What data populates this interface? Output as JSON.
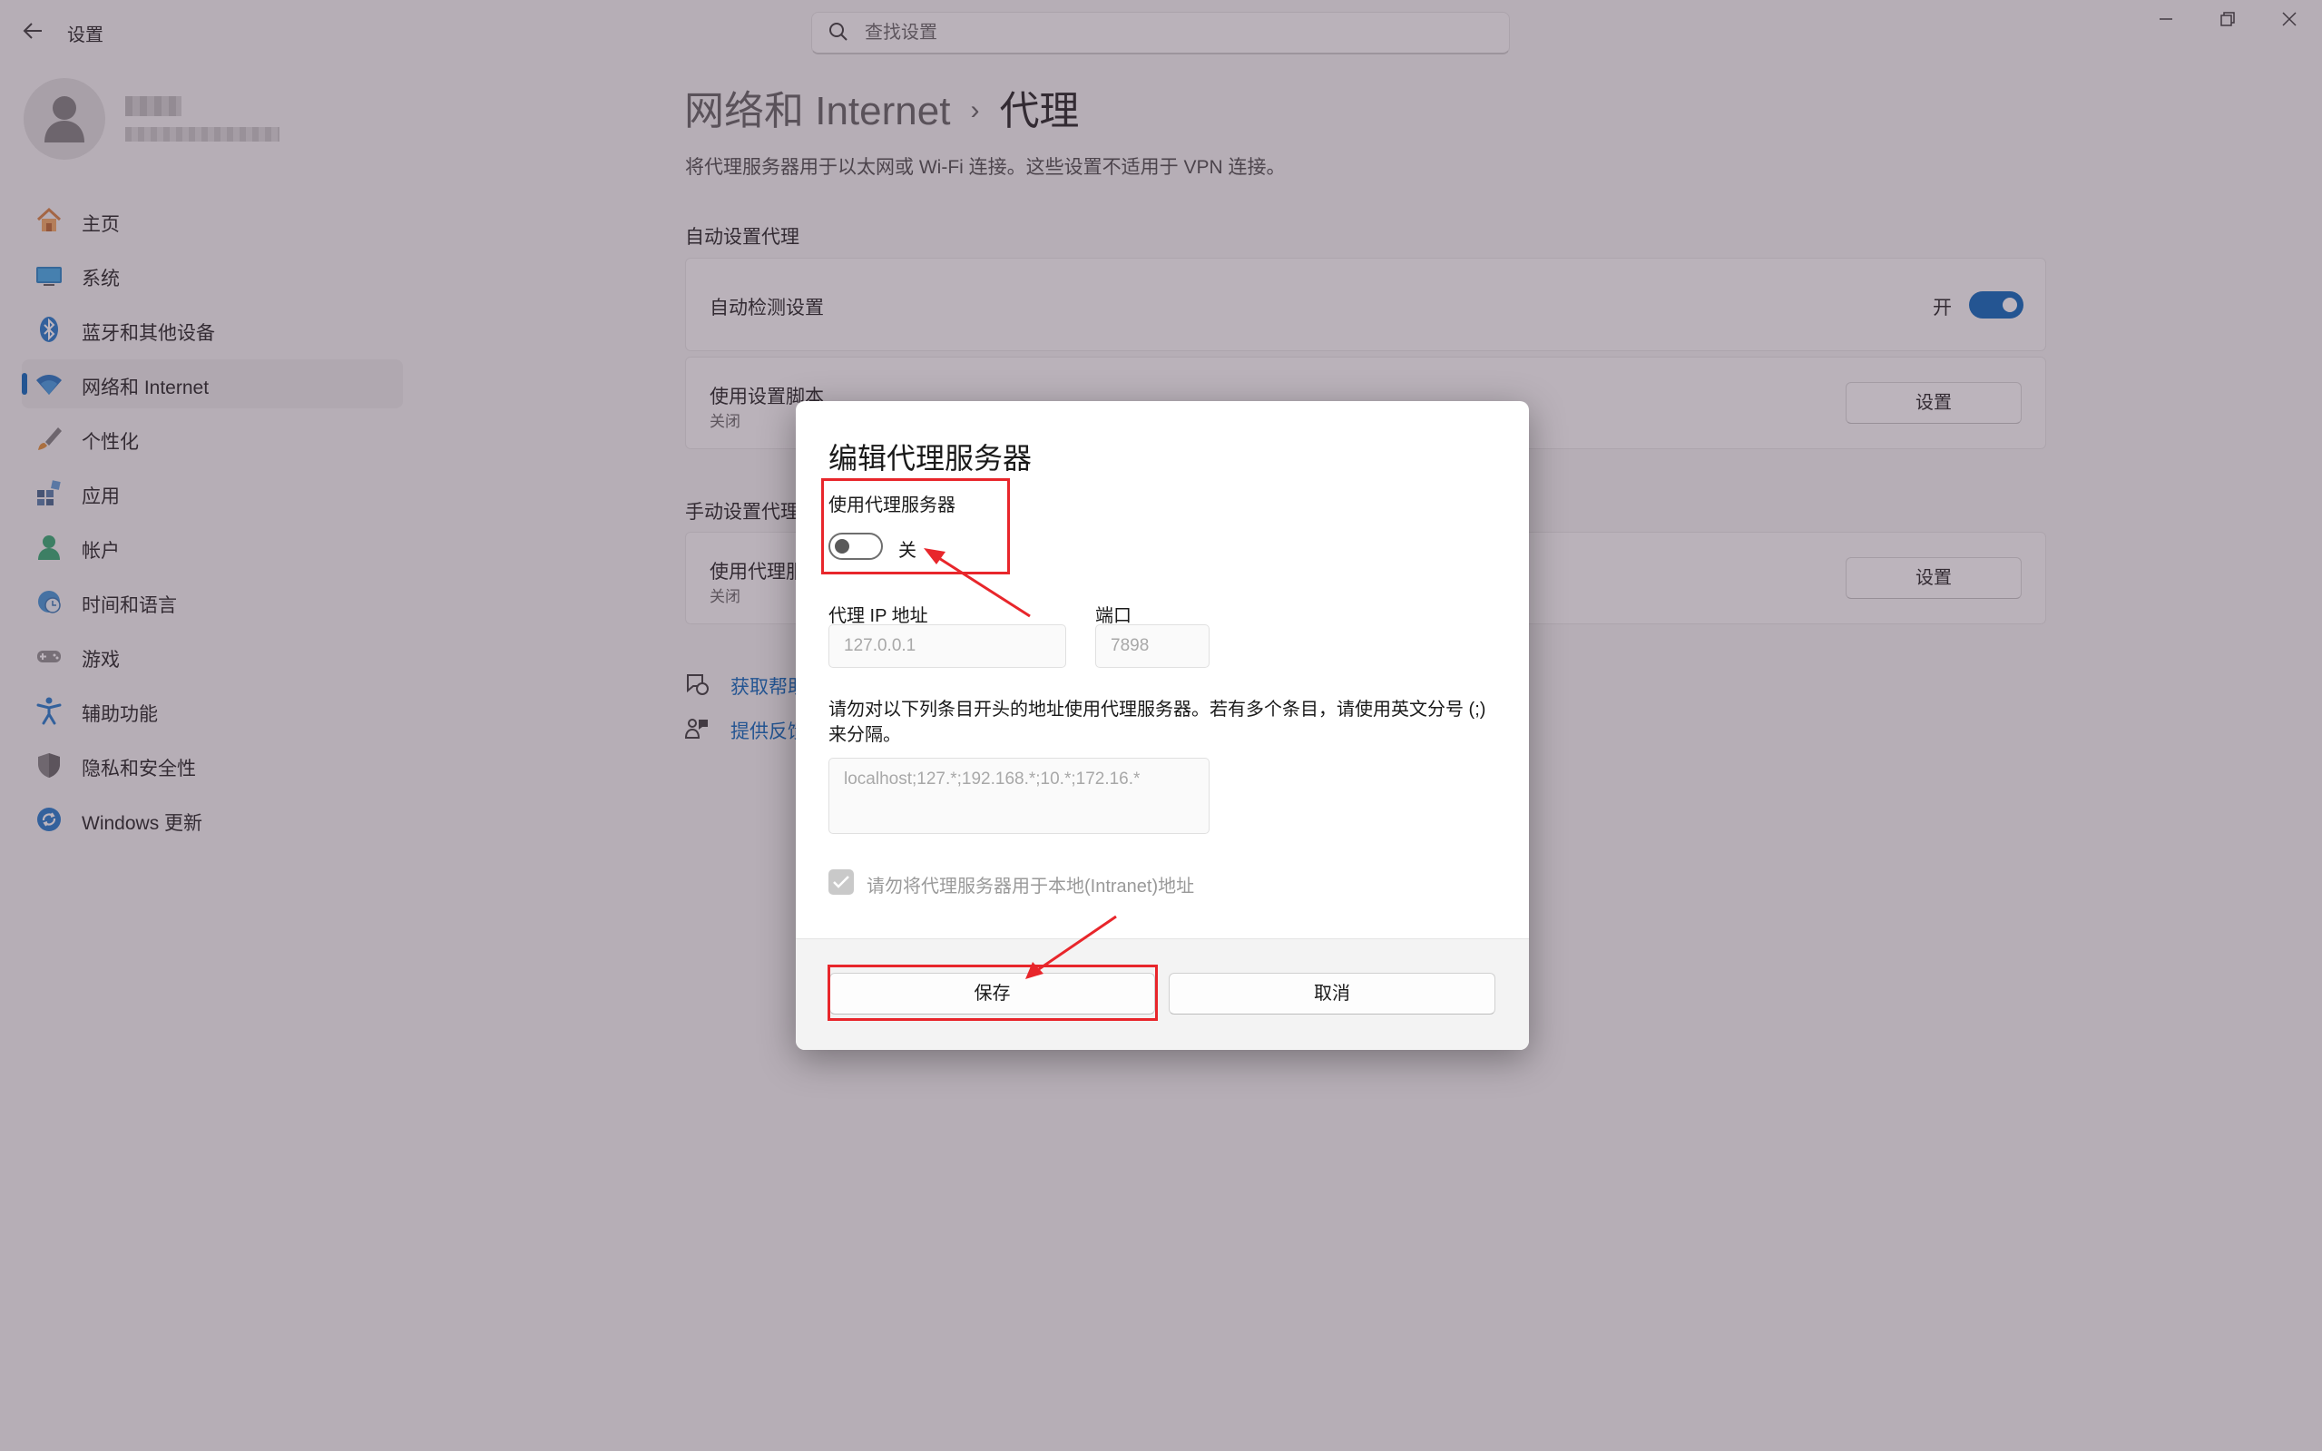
{
  "window": {
    "title": "设置",
    "back_icon": "arrow-left-icon",
    "controls": [
      "minimize-icon",
      "restore-icon",
      "close-icon"
    ]
  },
  "search": {
    "placeholder": "查找设置",
    "value": ""
  },
  "sidebar": {
    "items": [
      {
        "label": "主页",
        "icon": "home-icon"
      },
      {
        "label": "系统",
        "icon": "system-icon"
      },
      {
        "label": "蓝牙和其他设备",
        "icon": "bluetooth-icon"
      },
      {
        "label": "网络和 Internet",
        "icon": "wifi-icon",
        "active": true
      },
      {
        "label": "个性化",
        "icon": "brush-icon"
      },
      {
        "label": "应用",
        "icon": "apps-icon"
      },
      {
        "label": "帐户",
        "icon": "account-icon"
      },
      {
        "label": "时间和语言",
        "icon": "globe-clock-icon"
      },
      {
        "label": "游戏",
        "icon": "gamepad-icon"
      },
      {
        "label": "辅助功能",
        "icon": "accessibility-icon"
      },
      {
        "label": "隐私和安全性",
        "icon": "shield-icon"
      },
      {
        "label": "Windows 更新",
        "icon": "update-icon"
      }
    ]
  },
  "page": {
    "breadcrumb_parent": "网络和 Internet",
    "breadcrumb_sep": "›",
    "breadcrumb_current": "代理",
    "description": "将代理服务器用于以太网或 Wi-Fi 连接。这些设置不适用于 VPN 连接。",
    "auto_section": "自动设置代理",
    "auto_detect": {
      "label": "自动检测设置",
      "state": "开",
      "on": true
    },
    "setup_script": {
      "label": "使用设置脚本",
      "status": "关闭",
      "button": "设置"
    },
    "manual_section": "手动设置代理",
    "manual_proxy": {
      "label": "使用代理服",
      "status": "关闭",
      "button": "设置"
    },
    "links": [
      {
        "label": "获取帮助",
        "icon": "help-chat-icon"
      },
      {
        "label": "提供反馈",
        "icon": "feedback-icon"
      }
    ]
  },
  "dialog": {
    "title": "编辑代理服务器",
    "use_proxy_label": "使用代理服务器",
    "use_proxy_state": "关",
    "use_proxy_on": false,
    "ip_label": "代理 IP 地址",
    "ip_value": "127.0.0.1",
    "port_label": "端口",
    "port_value": "7898",
    "exceptions_label": "请勿对以下列条目开头的地址使用代理服务器。若有多个条目，请使用英文分号 (;) 来分隔。",
    "exceptions_value": "localhost;127.*;192.168.*;10.*;172.16.*",
    "bypass_local_label": "请勿将代理服务器用于本地(Intranet)地址",
    "bypass_local_checked": true,
    "save_button": "保存",
    "cancel_button": "取消"
  },
  "colors": {
    "accent": "#005fb8",
    "annotation_red": "#e8262b",
    "overlay": "#5a465a"
  }
}
